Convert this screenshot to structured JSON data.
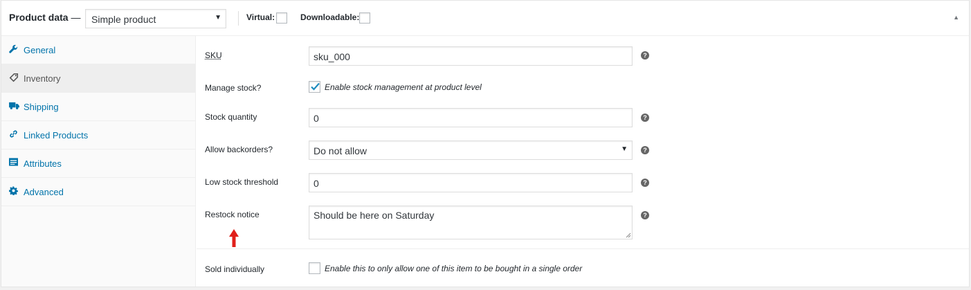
{
  "header": {
    "title": "Product data",
    "title_dash": "—",
    "product_type": "Simple product",
    "virtual_label": "Virtual:",
    "downloadable_label": "Downloadable:",
    "virtual_checked": false,
    "downloadable_checked": false
  },
  "tabs": [
    {
      "label": "General",
      "icon": "wrench-icon",
      "active": false
    },
    {
      "label": "Inventory",
      "icon": "tag-icon",
      "active": true
    },
    {
      "label": "Shipping",
      "icon": "truck-icon",
      "active": false
    },
    {
      "label": "Linked Products",
      "icon": "link-icon",
      "active": false
    },
    {
      "label": "Attributes",
      "icon": "attributes-icon",
      "active": false
    },
    {
      "label": "Advanced",
      "icon": "gear-icon",
      "active": false
    }
  ],
  "inventory": {
    "sku_label": "SKU",
    "sku_value": "sku_000",
    "manage_stock_label": "Manage stock?",
    "manage_stock_desc": "Enable stock management at product level",
    "manage_stock_checked": true,
    "stock_qty_label": "Stock quantity",
    "stock_qty_value": "0",
    "backorders_label": "Allow backorders?",
    "backorders_value": "Do not allow",
    "low_stock_label": "Low stock threshold",
    "low_stock_value": "0",
    "restock_label": "Restock notice",
    "restock_value": "Should be here on Saturday",
    "sold_individually_label": "Sold individually",
    "sold_individually_desc": "Enable this to only allow one of this item to be bought in a single order",
    "sold_individually_checked": false
  },
  "colors": {
    "link": "#0073aa",
    "check": "#1e8cbe",
    "annotation_arrow": "#e0201b"
  }
}
